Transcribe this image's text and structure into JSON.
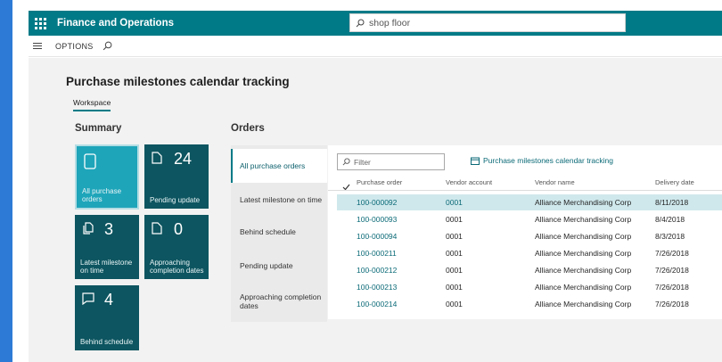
{
  "app": {
    "title": "Finance and Operations",
    "search_value": "shop floor"
  },
  "cmdbar": {
    "options_label": "OPTIONS"
  },
  "page": {
    "title": "Purchase milestones calendar tracking",
    "tab": "Workspace"
  },
  "summary": {
    "heading": "Summary",
    "tiles": [
      {
        "label": "All purchase orders",
        "count": "",
        "icon": "document-icon"
      },
      {
        "label": "Pending update",
        "count": "24",
        "icon": "page-icon"
      },
      {
        "label": "Latest milestone on time",
        "count": "3",
        "icon": "copy-icon"
      },
      {
        "label": "Approaching completion dates",
        "count": "0",
        "icon": "page-icon"
      },
      {
        "label": "Behind schedule",
        "count": "4",
        "icon": "comment-icon"
      }
    ]
  },
  "orders": {
    "heading": "Orders",
    "nav": [
      {
        "label": "All purchase orders"
      },
      {
        "label": "Latest milestone on time"
      },
      {
        "label": "Behind schedule"
      },
      {
        "label": "Pending update"
      },
      {
        "label": "Approaching completion dates"
      }
    ],
    "filter_placeholder": "Filter",
    "calendar_link": "Purchase milestones calendar tracking",
    "columns": [
      "Purchase order",
      "Vendor account",
      "Vendor name",
      "Delivery date"
    ],
    "rows": [
      {
        "po": "100-000092",
        "vendor_account": "0001",
        "vendor_name": "Alliance Merchandising Corp",
        "delivery_date": "8/11/2018"
      },
      {
        "po": "100-000093",
        "vendor_account": "0001",
        "vendor_name": "Alliance Merchandising Corp",
        "delivery_date": "8/4/2018"
      },
      {
        "po": "100-000094",
        "vendor_account": "0001",
        "vendor_name": "Alliance Merchandising Corp",
        "delivery_date": "8/3/2018"
      },
      {
        "po": "100-000211",
        "vendor_account": "0001",
        "vendor_name": "Alliance Merchandising Corp",
        "delivery_date": "7/26/2018"
      },
      {
        "po": "100-000212",
        "vendor_account": "0001",
        "vendor_name": "Alliance Merchandising Corp",
        "delivery_date": "7/26/2018"
      },
      {
        "po": "100-000213",
        "vendor_account": "0001",
        "vendor_name": "Alliance Merchandising Corp",
        "delivery_date": "7/26/2018"
      },
      {
        "po": "100-000214",
        "vendor_account": "0001",
        "vendor_name": "Alliance Merchandising Corp",
        "delivery_date": "7/26/2018"
      }
    ]
  },
  "colors": {
    "header_teal": "#007a87",
    "tile_dark": "#0d5560",
    "tile_selected": "#1ea5ba",
    "link": "#0b6a77",
    "left_strip": "#2d7ad6"
  }
}
